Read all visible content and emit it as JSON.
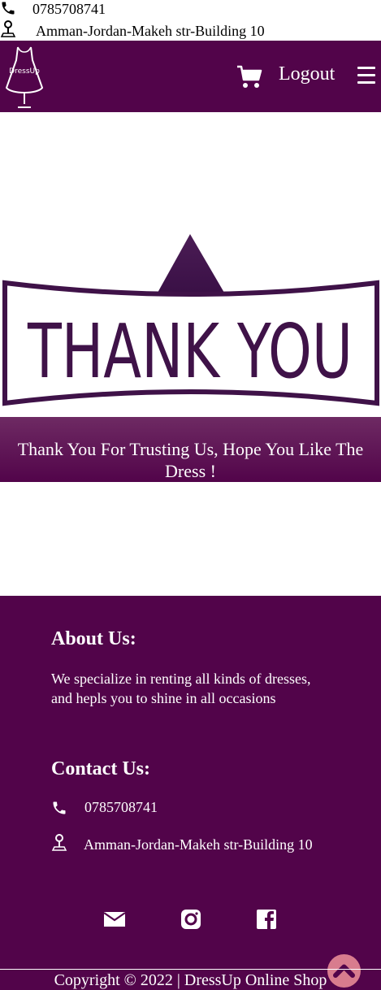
{
  "topbar": {
    "phone": "0785708741",
    "address": "Amman-Jordan-Makeh str-Building 10",
    "phone_icon": "phone-icon",
    "address_icon": "location-pin-icon"
  },
  "navbar": {
    "logo_text": "DressUp",
    "cart_icon": "shopping-cart-icon",
    "logout_label": "Logout",
    "menu_icon": "hamburger-menu-icon",
    "background": "#52044a"
  },
  "hero": {
    "image_text": "THANK YOU"
  },
  "banner": {
    "message": "Thank You For Trusting Us, Hope You Like The Dress !"
  },
  "footer": {
    "about_title": "About Us:",
    "about_text": "We specialize in renting all kinds of dresses, and hepls you to shine in all occasions",
    "contact_title": "Contact Us:",
    "phone": "0785708741",
    "address": "Amman-Jordan-Makeh str-Building 10",
    "social": [
      "mail-icon",
      "instagram-icon",
      "facebook-icon"
    ],
    "scroll_top_icon": "chevron-up-icon",
    "copyright": "Copyright © 2022 | DressUp Online Shop",
    "accent": "#d87c8e"
  }
}
